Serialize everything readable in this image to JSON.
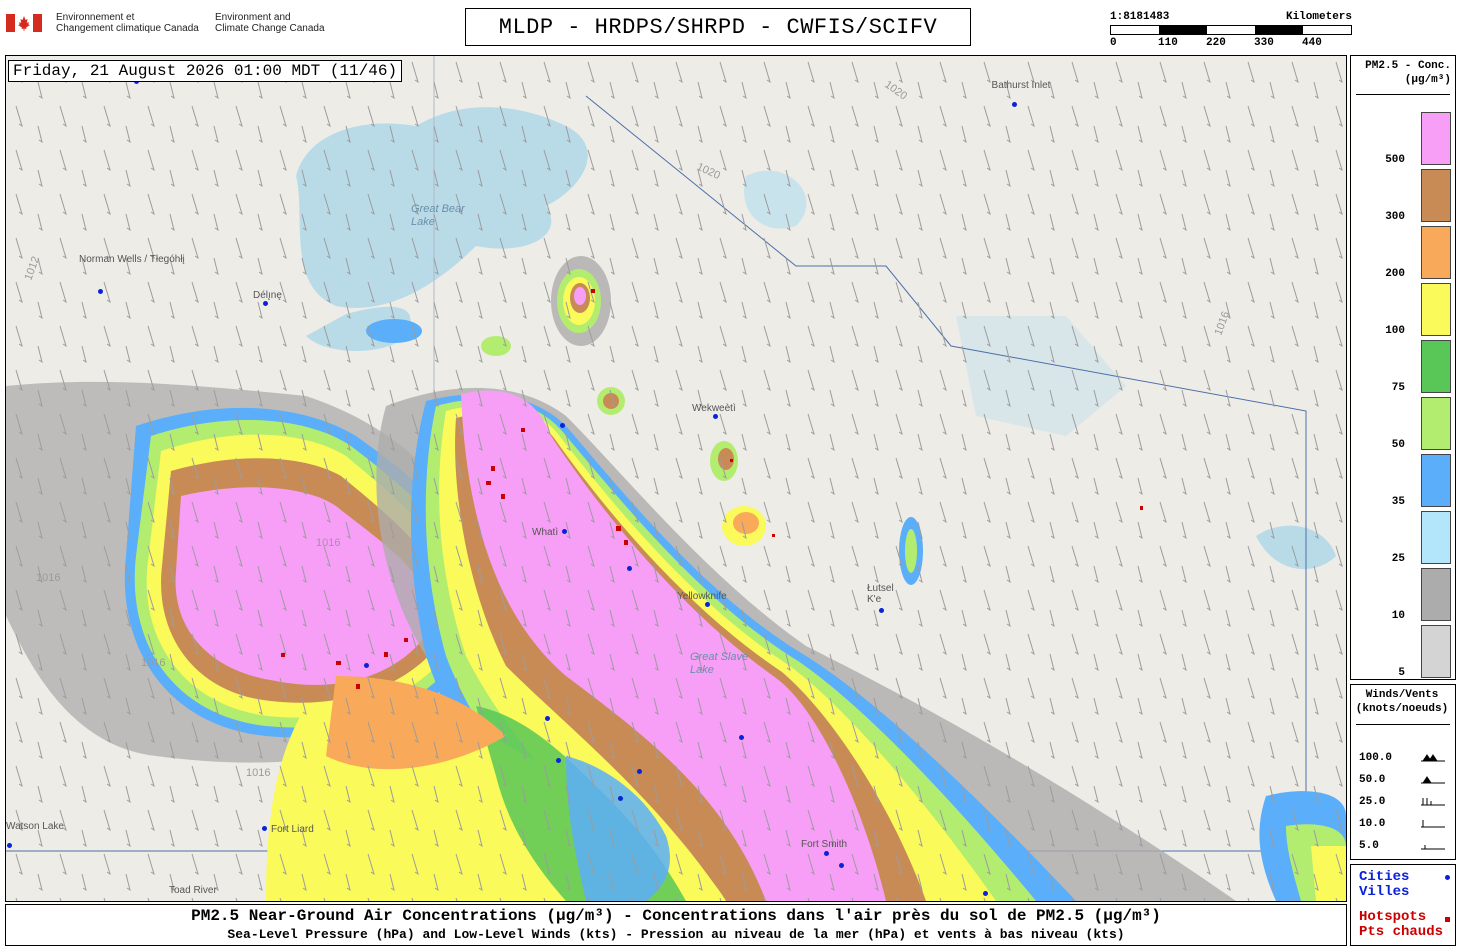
{
  "header": {
    "gov_fr": [
      "Environnement et",
      "Changement climatique Canada"
    ],
    "gov_en": [
      "Environment and",
      "Climate Change Canada"
    ],
    "title": "MLDP - HRDPS/SHRPD - CWFIS/SCIFV",
    "scale_ratio": "1:8181483",
    "scale_unit": "Kilometers",
    "scale_ticks": [
      "0",
      "110",
      "220",
      "330",
      "440"
    ]
  },
  "map": {
    "timestamp": "Friday, 21 August 2026 01:00 MDT (11/46)",
    "water_labels": [
      {
        "text": "Great Bear\nLake"
      },
      {
        "text": "Great Slave\nLake"
      }
    ],
    "cities": [
      "Norman Wells / Tłegóhłį",
      "Délı̨nę",
      "Bathurst Inlet",
      "Wekweètì",
      "Whatì",
      "Yellowknife",
      "Łutsel K'e",
      "Fort Smith",
      "Fort Liard",
      "Toad River",
      "Watson Lake"
    ],
    "isobar_labels": [
      "1020",
      "1020",
      "1016",
      "1012",
      "1016",
      "1016",
      "1016",
      "1016"
    ]
  },
  "legend": {
    "title": [
      "PM2.5 - Conc.",
      "(μg/m³)"
    ],
    "bins": [
      {
        "label": "500",
        "color": "#f79ef7"
      },
      {
        "label": "300",
        "color": "#c98b56"
      },
      {
        "label": "200",
        "color": "#f8a95a"
      },
      {
        "label": "100",
        "color": "#fafa5a"
      },
      {
        "label": "75",
        "color": "#58c758"
      },
      {
        "label": "50",
        "color": "#b3ed70"
      },
      {
        "label": "35",
        "color": "#5aaefa"
      },
      {
        "label": "25",
        "color": "#b3e6fa"
      },
      {
        "label": "10",
        "color": "#acacac"
      },
      {
        "label": "5",
        "color": "#d4d4d4"
      }
    ]
  },
  "winds": {
    "title": [
      "Winds/Vents",
      "(knots/noeuds)"
    ],
    "rows": [
      "100.0",
      "50.0",
      "25.0",
      "10.0",
      "5.0"
    ]
  },
  "key": {
    "cities": [
      "Cities",
      "Villes"
    ],
    "hotspots": [
      "Hotspots",
      "Pts chauds"
    ],
    "city_color": "#0a22d8",
    "hotspot_color": "#cc0000"
  },
  "caption": {
    "line1": "PM2.5 Near-Ground Air Concentrations (μg/m³) - Concentrations dans l'air près du sol de PM2.5 (μg/m³)",
    "line2": "Sea-Level Pressure (hPa) and Low-Level Winds (kts) - Pression au niveau de la mer (hPa) et vents à bas niveau (kts)"
  }
}
